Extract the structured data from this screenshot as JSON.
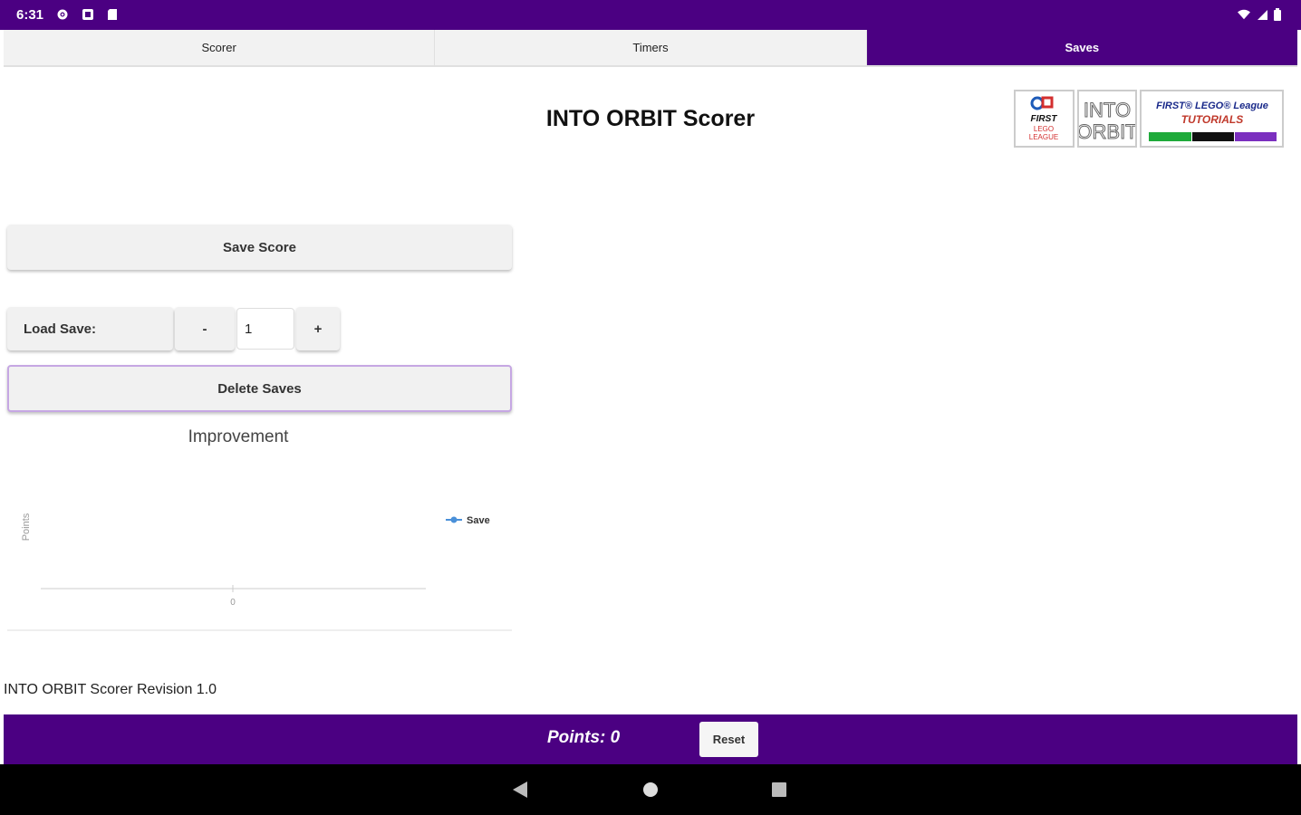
{
  "status_bar": {
    "time": "6:31"
  },
  "tabs": [
    {
      "label": "Scorer"
    },
    {
      "label": "Timers"
    },
    {
      "label": "Saves"
    }
  ],
  "page": {
    "title": "INTO ORBIT Scorer"
  },
  "logos": [
    {
      "name": "first-lego-league-logo",
      "text": "FIRST LEGO LEAGUE"
    },
    {
      "name": "into-orbit-logo",
      "text": "INTO ORBIT"
    },
    {
      "name": "fll-tutorials-logo",
      "text": "FIRST LEGO League TUTORIALS"
    }
  ],
  "saves": {
    "save_button": "Save Score",
    "load_label": "Load Save:",
    "minus": "-",
    "plus": "+",
    "slot_value": "1",
    "delete_button": "Delete Saves"
  },
  "chart_data": {
    "type": "line",
    "title": "Improvement",
    "ylabel": "Points",
    "xlabel": "",
    "x_ticks": [
      "0"
    ],
    "series": [
      {
        "name": "Save",
        "values": [],
        "color": "#4a90d9"
      }
    ],
    "legend": "right",
    "grid": false
  },
  "footer": {
    "revision": "INTO ORBIT Scorer Revision 1.0"
  },
  "bottom_bar": {
    "points": "Points: 0",
    "reset": "Reset"
  },
  "colors": {
    "accent": "#4b0082",
    "tab_bg": "#f2f2f2",
    "button_bg": "#f1f1f1"
  }
}
